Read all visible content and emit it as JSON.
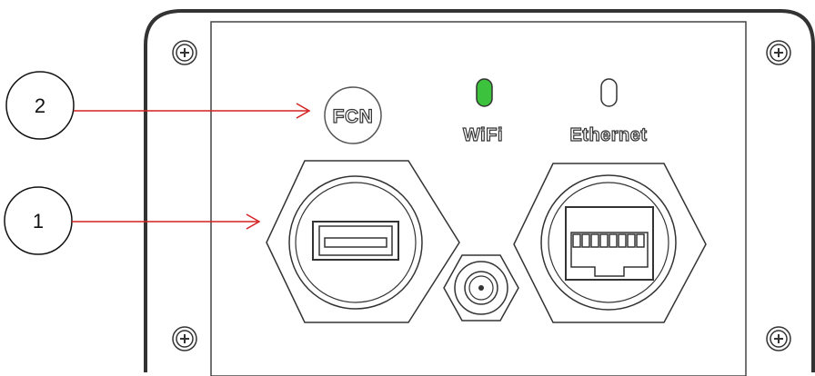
{
  "callouts": [
    {
      "number": "2",
      "target": "FCN button"
    },
    {
      "number": "1",
      "target": "USB port"
    }
  ],
  "panel": {
    "fcn_button_label": "FCN",
    "wifi_label": "WiFi",
    "ethernet_label": "Ethernet"
  },
  "colors": {
    "callout_arrow": "#d42020",
    "wifi_led": "#3cc23c",
    "ethernet_led": "#ffffff",
    "outline": "#333333"
  },
  "icons": [
    "screw-icon",
    "usb-port-icon",
    "rj45-port-icon",
    "coax-connector-icon"
  ]
}
